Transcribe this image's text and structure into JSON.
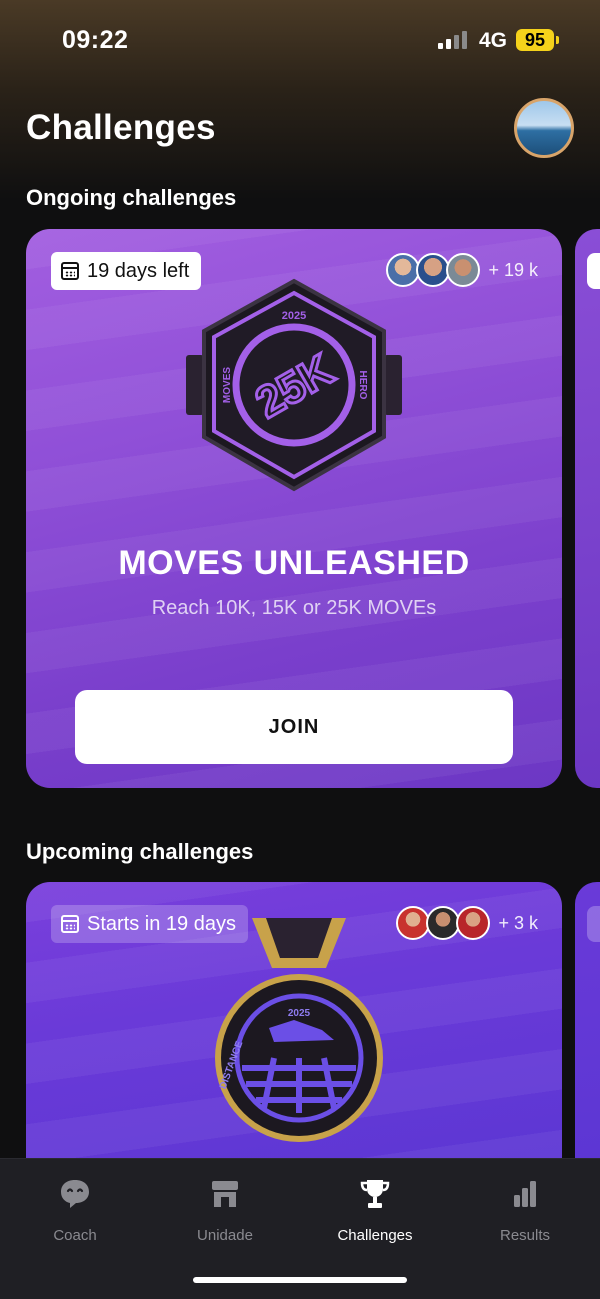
{
  "status_bar": {
    "time": "09:22",
    "network": "4G",
    "battery": "95"
  },
  "header": {
    "title": "Challenges"
  },
  "sections": {
    "ongoing": {
      "title": "Ongoing challenges",
      "card": {
        "date_tag": "19 days left",
        "participants_count": "+ 19 k",
        "badge": {
          "year": "2025",
          "label": "25K",
          "left_text": "MOVES",
          "right_text": "HERO"
        },
        "title": "MOVES UNLEASHED",
        "subtitle": "Reach 10K, 15K or 25K MOVEs",
        "button": "JOIN"
      }
    },
    "upcoming": {
      "title": "Upcoming challenges",
      "card": {
        "date_tag": "Starts in 19 days",
        "participants_count": "+ 3 k",
        "badge": {
          "year": "2025",
          "left_text": "DISTANCE"
        }
      }
    }
  },
  "tab_bar": {
    "items": [
      {
        "label": "Coach",
        "icon": "chat-bubble-icon"
      },
      {
        "label": "Unidade",
        "icon": "store-icon"
      },
      {
        "label": "Challenges",
        "icon": "trophy-icon",
        "active": true
      },
      {
        "label": "Results",
        "icon": "bar-chart-icon"
      }
    ]
  },
  "colors": {
    "card_purple": "#8f4fd7",
    "card_upcoming": "#6a3ad8",
    "battery": "#f5d21b",
    "background": "#0f0f10"
  }
}
